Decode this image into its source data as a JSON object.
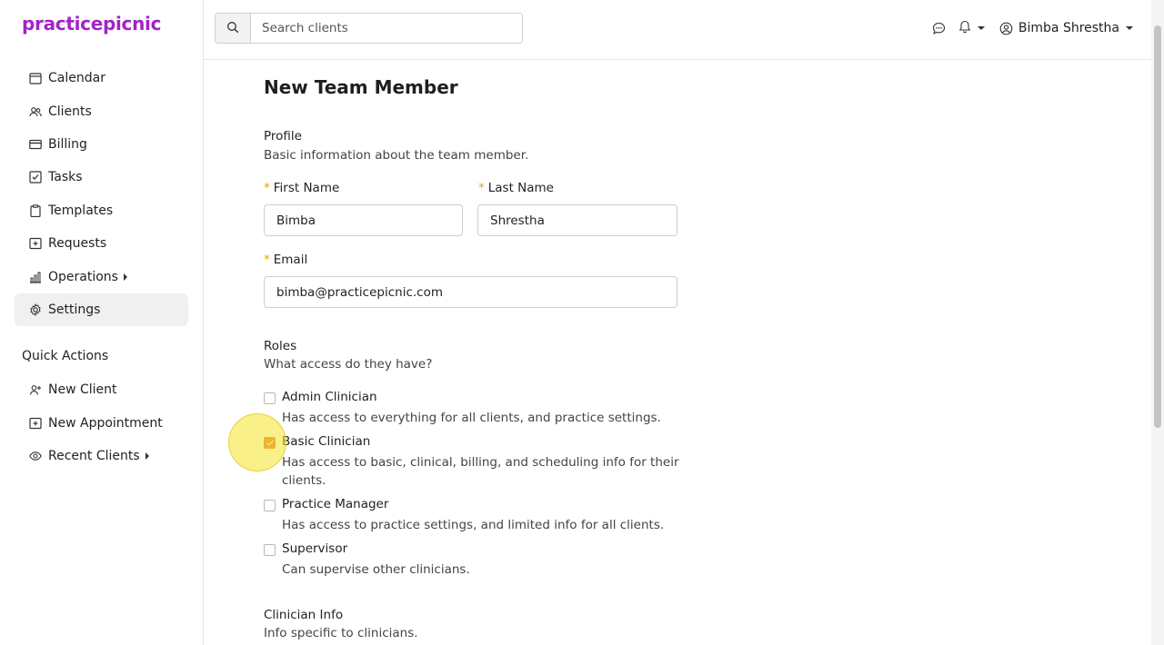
{
  "brand": {
    "logo": "practicepicnic",
    "color": "#a323c9"
  },
  "sidebar": {
    "items": [
      {
        "label": "Calendar",
        "icon": "calendar-icon"
      },
      {
        "label": "Clients",
        "icon": "users-icon"
      },
      {
        "label": "Billing",
        "icon": "credit-card-icon"
      },
      {
        "label": "Tasks",
        "icon": "checkbox-icon"
      },
      {
        "label": "Templates",
        "icon": "clipboard-icon"
      },
      {
        "label": "Requests",
        "icon": "plus-square-icon"
      },
      {
        "label": "Operations",
        "icon": "bar-chart-icon",
        "expandable": true
      },
      {
        "label": "Settings",
        "icon": "gear-icon",
        "active": true
      }
    ],
    "quick_actions_title": "Quick Actions",
    "quick_actions": [
      {
        "label": "New Client",
        "icon": "user-plus-icon"
      },
      {
        "label": "New Appointment",
        "icon": "plus-square-icon"
      },
      {
        "label": "Recent Clients",
        "icon": "eye-icon",
        "expandable": true
      }
    ]
  },
  "topbar": {
    "search_placeholder": "Search clients",
    "user_name": "Bimba Shrestha"
  },
  "form": {
    "title": "New Team Member",
    "profile": {
      "title": "Profile",
      "subtitle": "Basic information about the team member.",
      "first_name_label": "First Name",
      "first_name_value": "Bimba",
      "last_name_label": "Last Name",
      "last_name_value": "Shrestha",
      "email_label": "Email",
      "email_value": "bimba@practicepicnic.com",
      "required_marker": "*"
    },
    "roles": {
      "title": "Roles",
      "subtitle": "What access do they have?",
      "items": [
        {
          "name": "Admin Clinician",
          "desc": "Has access to everything for all clients, and practice settings.",
          "checked": false
        },
        {
          "name": "Basic Clinician",
          "desc": "Has access to basic, clinical, billing, and scheduling info for their clients.",
          "checked": true
        },
        {
          "name": "Practice Manager",
          "desc": "Has access to practice settings, and limited info for all clients.",
          "checked": false
        },
        {
          "name": "Supervisor",
          "desc": "Can supervise other clinicians.",
          "checked": false
        }
      ]
    },
    "clinician_info": {
      "title": "Clinician Info",
      "subtitle": "Info specific to clinicians."
    }
  },
  "colors": {
    "accent": "#e07a3c",
    "required": "#e8a400"
  }
}
